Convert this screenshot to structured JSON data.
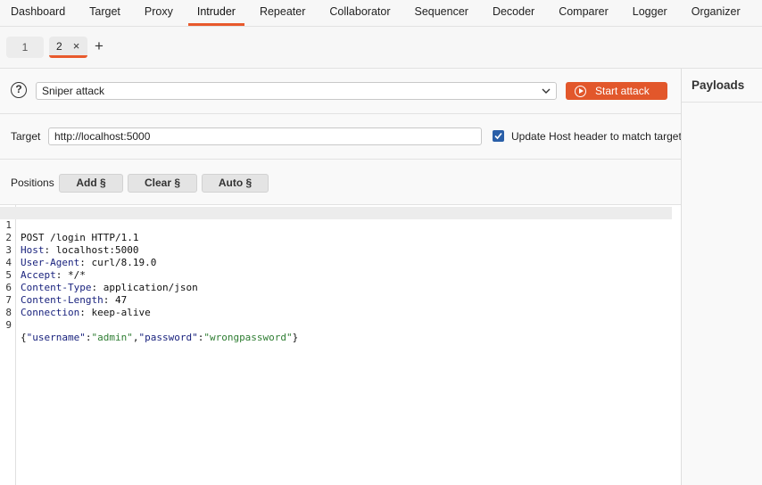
{
  "topnav": {
    "tabs": [
      {
        "label": "Dashboard"
      },
      {
        "label": "Target"
      },
      {
        "label": "Proxy"
      },
      {
        "label": "Intruder"
      },
      {
        "label": "Repeater"
      },
      {
        "label": "Collaborator"
      },
      {
        "label": "Sequencer"
      },
      {
        "label": "Decoder"
      },
      {
        "label": "Comparer"
      },
      {
        "label": "Logger"
      },
      {
        "label": "Organizer"
      }
    ],
    "active": "Intruder"
  },
  "subtabs": {
    "tab1": "1",
    "tab2": "2",
    "close_glyph": "×",
    "add_glyph": "+"
  },
  "attack": {
    "help_glyph": "?",
    "type": "Sniper attack",
    "start_label": "Start attack"
  },
  "target": {
    "label": "Target",
    "url": "http://localhost:5000",
    "update_host_label": "Update Host header to match target",
    "update_host_checked": true
  },
  "positions": {
    "label": "Positions",
    "add_label": "Add §",
    "clear_label": "Clear §",
    "auto_label": "Auto §"
  },
  "request": {
    "line_numbers": [
      "1",
      "2",
      "3",
      "4",
      "5",
      "6",
      "7",
      "8",
      "9"
    ],
    "line1": "POST /login HTTP/1.1",
    "headers": [
      {
        "name": "Host",
        "value": "localhost:5000"
      },
      {
        "name": "User-Agent",
        "value": "curl/8.19.0"
      },
      {
        "name": "Accept",
        "value": "*/*"
      },
      {
        "name": "Content-Type",
        "value": "application/json"
      },
      {
        "name": "Content-Length",
        "value": "47"
      },
      {
        "name": "Connection",
        "value": "keep-alive"
      }
    ],
    "body": {
      "k1": "\"username\"",
      "v1": "\"admin\"",
      "k2": "\"password\"",
      "v2": "\"wrongpassword\""
    }
  },
  "payloads": {
    "title": "Payloads"
  },
  "colors": {
    "accent": "#e8592c",
    "start_button": "#e2572b",
    "checkbox": "#2a5fa8"
  }
}
